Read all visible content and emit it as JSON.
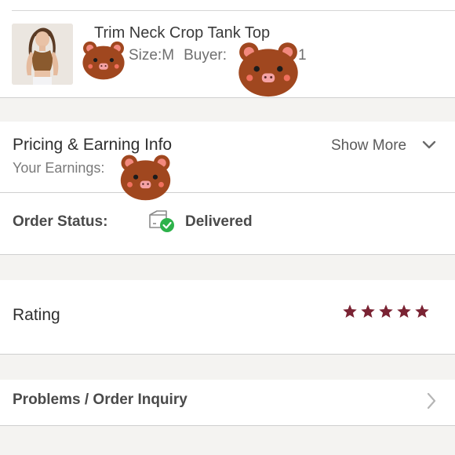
{
  "item": {
    "title": "Trim Neck Crop Tank Top",
    "size_text": "Size:M",
    "buyer_label": "Buyer:",
    "buyer_tail": "1"
  },
  "pricing": {
    "title": "Pricing & Earning Info",
    "earnings_label": "Your Earnings:",
    "show_more_label": "Show More",
    "chevron_icon": "chevron-down-icon"
  },
  "order_status": {
    "label": "Order Status:",
    "value": "Delivered",
    "icon": "delivered-box-icon",
    "check_color": "#2db24a"
  },
  "rating": {
    "label": "Rating",
    "stars": 5,
    "max_stars": 5,
    "star_color": "#7a2333"
  },
  "problems": {
    "label": "Problems / Order Inquiry",
    "chevron_icon": "chevron-right-icon"
  },
  "stickers": {
    "name": "bear-sticker",
    "color": "#a0471f"
  }
}
